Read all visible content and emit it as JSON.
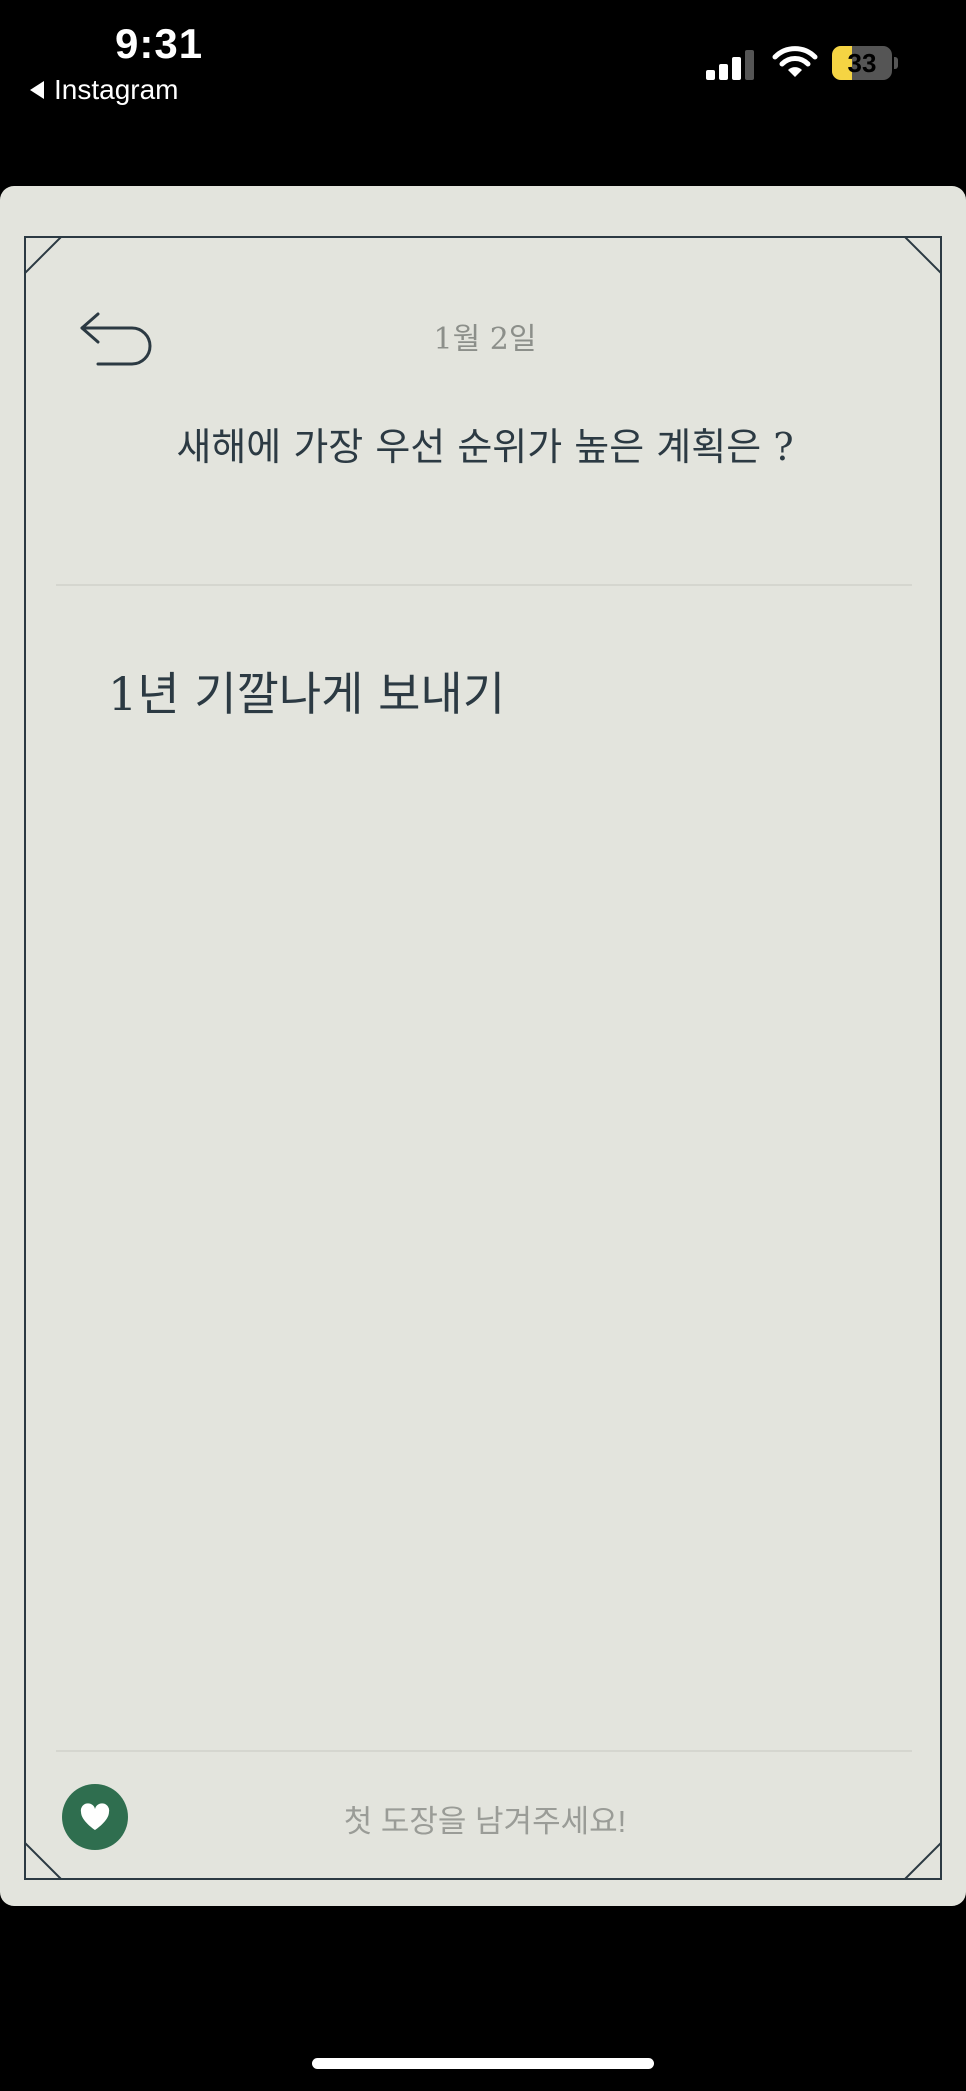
{
  "status_bar": {
    "time": "9:31",
    "back_app_label": "Instagram",
    "battery_percent": "33",
    "battery_level": 0.33,
    "signal_bars_active": 3,
    "signal_bars_total": 4
  },
  "card": {
    "date": "1월 2일",
    "question": "새해에 가장 우선 순위가 높은 계획은 ?",
    "answer": "1년 기깔나게 보내기",
    "stamp_prompt": "첫 도장을 남겨주세요!"
  },
  "colors": {
    "paper": "#e3e4dd",
    "frame": "#2c3a43",
    "heart_button": "#2f6e4f",
    "battery_fill": "#f5d443"
  },
  "icons": {
    "back": "undo-arrow-icon",
    "heart": "heart-icon",
    "signal": "cellular-signal-icon",
    "wifi": "wifi-icon",
    "battery": "battery-icon"
  }
}
